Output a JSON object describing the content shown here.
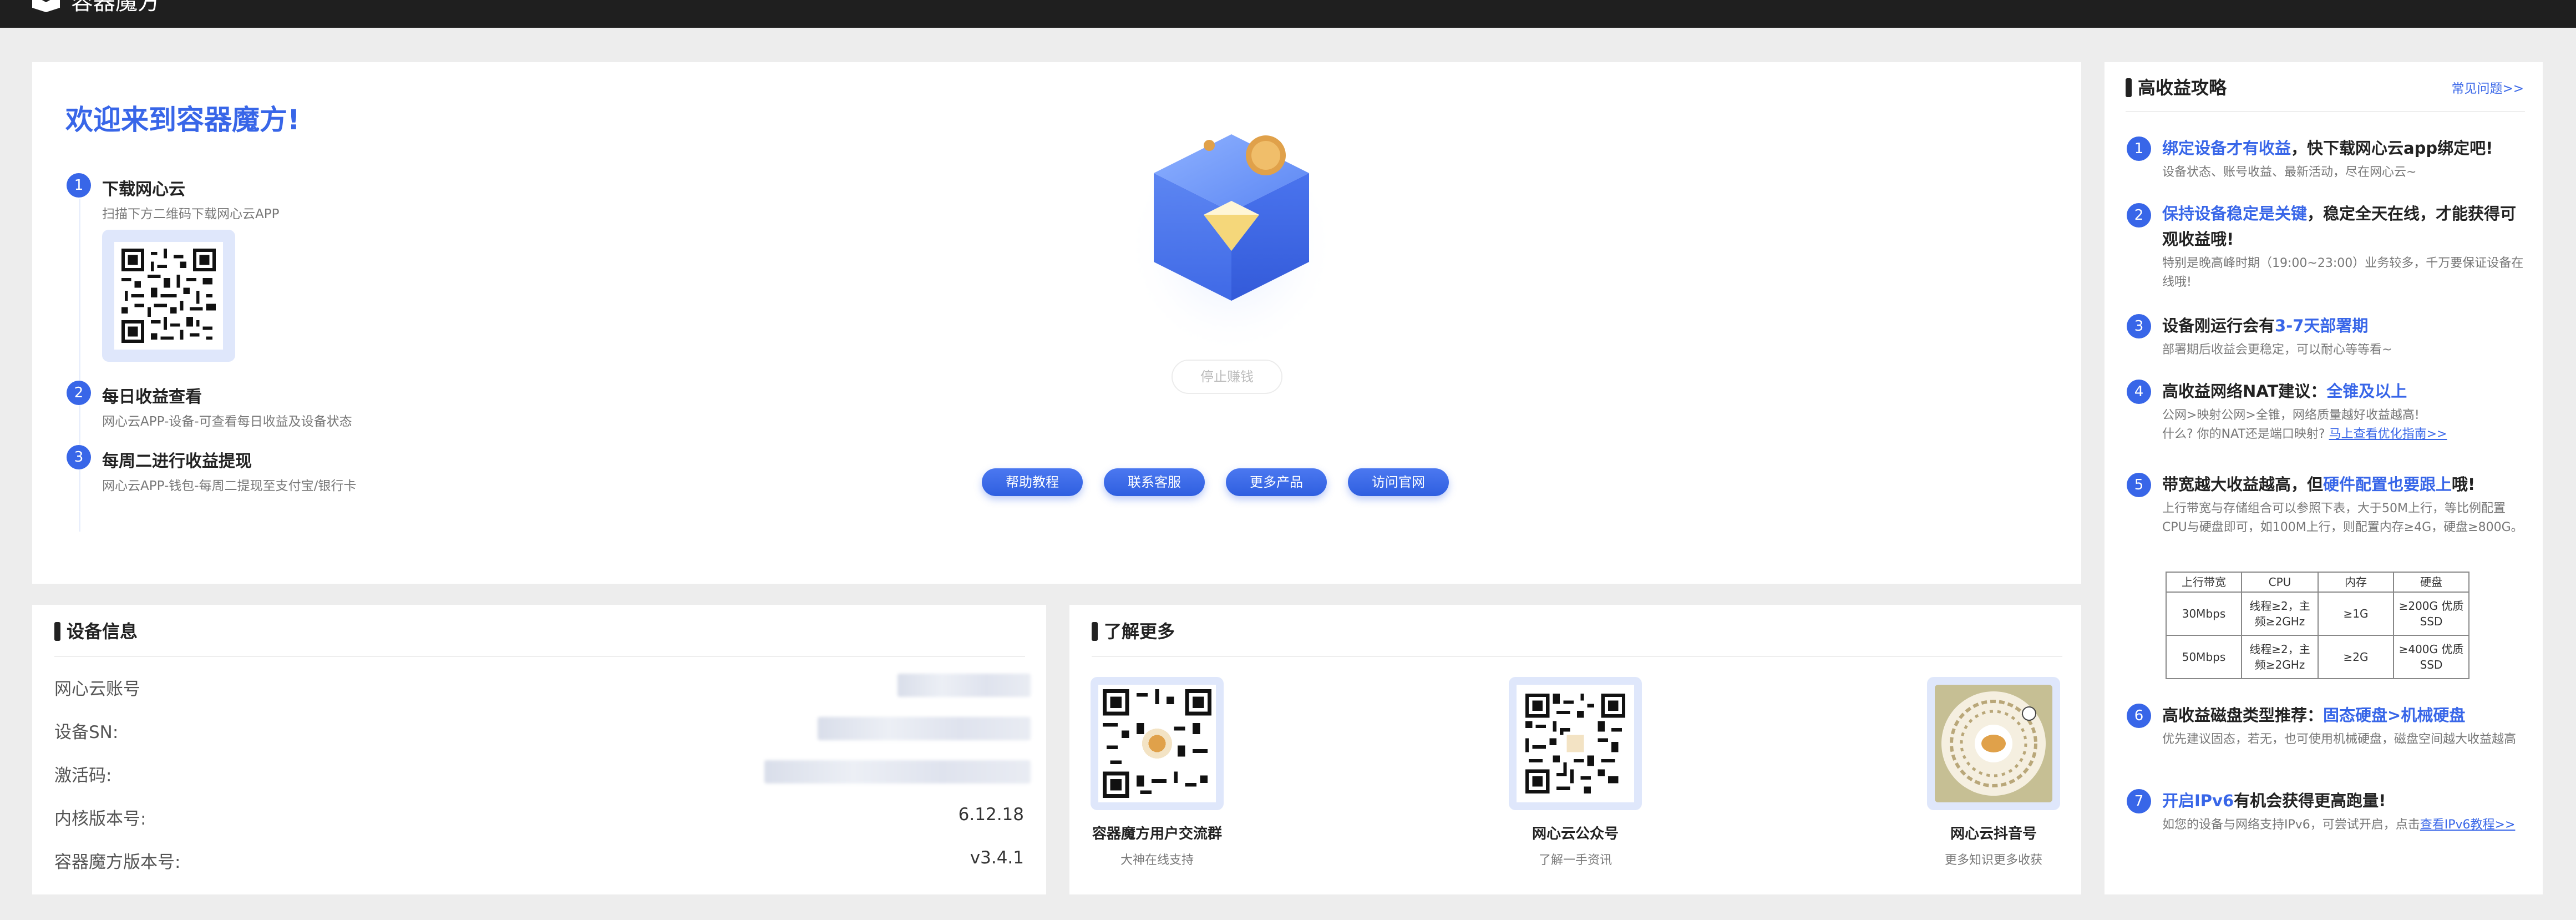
{
  "app": {
    "title": "容器魔方"
  },
  "welcome": {
    "title": "欢迎来到容器魔方!",
    "steps": [
      {
        "num": "1",
        "title": "下载网心云",
        "desc": "扫描下方二维码下载网心云APP"
      },
      {
        "num": "2",
        "title": "每日收益查看",
        "desc": "网心云APP-设备-可查看每日收益及设备状态"
      },
      {
        "num": "3",
        "title": "每周二进行收益提现",
        "desc": "网心云APP-钱包-每周二提现至支付宝/银行卡"
      }
    ],
    "stop_button": "停止赚钱",
    "buttons": [
      "帮助教程",
      "联系客服",
      "更多产品",
      "访问官网"
    ]
  },
  "strategy": {
    "title": "高收益攻略",
    "faq_link": "常见问题>>",
    "tips": [
      {
        "num": "1",
        "hl": "绑定设备才有收益",
        "rest": "，快下载网心云app绑定吧!",
        "desc": "设备状态、账号收益、最新活动，尽在网心云~"
      },
      {
        "num": "2",
        "hl": "保持设备稳定是关键",
        "rest": "，稳定全天在线，才能获得可观收益哦!",
        "desc": "特别是晚高峰时期（19:00~23:00）业务较多，千万要保证设备在线哦!"
      },
      {
        "num": "3",
        "pre": "设备刚运行会有",
        "hl": "3-7天部署期",
        "desc": "部署期后收益会更稳定，可以耐心等等看~"
      },
      {
        "num": "4",
        "pre": "高收益网络NAT建议：",
        "hl": "全锥及以上",
        "desc": "公网>映射公网>全锥，网络质量越好收益越高!",
        "desc2": "什么? 你的NAT还是端口映射? ",
        "link": "马上查看优化指南>>"
      },
      {
        "num": "5",
        "pre": "带宽越大收益越高，但",
        "hl": "硬件配置也要跟上",
        "rest": "哦!",
        "desc": "上行带宽与存储组合可以参照下表，大于50M上行，等比例配置CPU与硬盘即可，如100M上行，则配置内存≥4G，硬盘≥800G。"
      },
      {
        "num": "6",
        "pre": "高收益磁盘类型推荐：",
        "hl": "固态硬盘>机械硬盘",
        "desc": "优先建议固态，若无，也可使用机械硬盘，磁盘空间越大收益越高"
      },
      {
        "num": "7",
        "hl": "开启IPv6",
        "rest": "有机会获得更高跑量!",
        "desc": "如您的设备与网络支持IPv6，可尝试开启，点击",
        "link": "查看IPv6教程>>"
      }
    ],
    "spec_table": {
      "headers": [
        "上行带宽",
        "CPU",
        "内存",
        "硬盘"
      ],
      "rows": [
        [
          "30Mbps",
          "线程≥2，主频≥2GHz",
          "≥1G",
          "≥200G 优质SSD"
        ],
        [
          "50Mbps",
          "线程≥2，主频≥2GHz",
          "≥2G",
          "≥400G 优质SSD"
        ]
      ]
    }
  },
  "device": {
    "title": "设备信息",
    "rows": [
      {
        "label": "网心云账号",
        "value": ""
      },
      {
        "label": "设备SN:",
        "value": ""
      },
      {
        "label": "激活码:",
        "value": ""
      },
      {
        "label": "内核版本号:",
        "value": "6.12.18"
      },
      {
        "label": "容器魔方版本号:",
        "value": "v3.4.1"
      }
    ]
  },
  "learn": {
    "title": "了解更多",
    "cards": [
      {
        "label": "容器魔方用户交流群",
        "sub": "大神在线支持"
      },
      {
        "label": "网心云公众号",
        "sub": "了解一手资讯"
      },
      {
        "label": "网心云抖音号",
        "sub": "更多知识更多收获"
      }
    ]
  },
  "colors": {
    "accent": "#3866e8",
    "topbar": "#1f1f1f",
    "background": "#ededed"
  }
}
